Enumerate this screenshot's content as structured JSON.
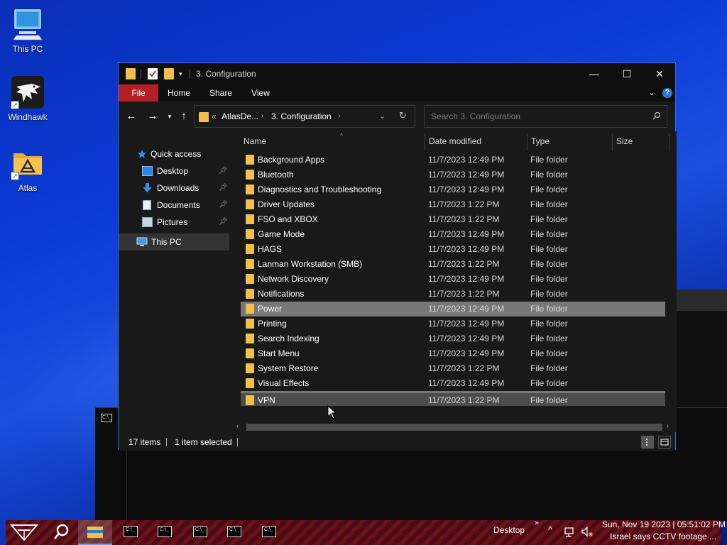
{
  "desktop": {
    "icons": [
      {
        "label": "This PC"
      },
      {
        "label": "Windhawk"
      },
      {
        "label": "Atlas"
      }
    ]
  },
  "explorer": {
    "title": "3. Configuration",
    "ribbon": {
      "file": "File",
      "home": "Home",
      "share": "Share",
      "view": "View",
      "help": "?"
    },
    "address": {
      "overflow": "«",
      "parent": "AtlasDe...",
      "current": "3. Configuration"
    },
    "search_placeholder": "Search 3. Configuration",
    "sidebar": {
      "quick_access": "Quick access",
      "items": [
        {
          "label": "Desktop",
          "icon": "desktop-icon",
          "pinned": true
        },
        {
          "label": "Downloads",
          "icon": "download-icon",
          "pinned": true
        },
        {
          "label": "Documents",
          "icon": "documents-icon",
          "pinned": true
        },
        {
          "label": "Pictures",
          "icon": "pictures-icon",
          "pinned": true
        }
      ],
      "this_pc": "This PC"
    },
    "columns": {
      "name": "Name",
      "date": "Date modified",
      "type": "Type",
      "size": "Size"
    },
    "rows": [
      {
        "name": "Background Apps",
        "date": "11/7/2023 12:49 PM",
        "type": "File folder"
      },
      {
        "name": "Bluetooth",
        "date": "11/7/2023 12:49 PM",
        "type": "File folder"
      },
      {
        "name": "Diagnostics and Troubleshooting",
        "date": "11/7/2023 12:49 PM",
        "type": "File folder"
      },
      {
        "name": "Driver Updates",
        "date": "11/7/2023 1:22 PM",
        "type": "File folder"
      },
      {
        "name": "FSO and XBOX",
        "date": "11/7/2023 1:22 PM",
        "type": "File folder"
      },
      {
        "name": "Game Mode",
        "date": "11/7/2023 12:49 PM",
        "type": "File folder"
      },
      {
        "name": "HAGS",
        "date": "11/7/2023 12:49 PM",
        "type": "File folder"
      },
      {
        "name": "Lanman Workstation (SMB)",
        "date": "11/7/2023 1:22 PM",
        "type": "File folder"
      },
      {
        "name": "Network Discovery",
        "date": "11/7/2023 12:49 PM",
        "type": "File folder"
      },
      {
        "name": "Notifications",
        "date": "11/7/2023 1:22 PM",
        "type": "File folder"
      },
      {
        "name": "Power",
        "date": "11/7/2023 12:49 PM",
        "type": "File folder"
      },
      {
        "name": "Printing",
        "date": "11/7/2023 12:49 PM",
        "type": "File folder"
      },
      {
        "name": "Search Indexing",
        "date": "11/7/2023 12:49 PM",
        "type": "File folder"
      },
      {
        "name": "Start Menu",
        "date": "11/7/2023 12:49 PM",
        "type": "File folder"
      },
      {
        "name": "System Restore",
        "date": "11/7/2023 1:22 PM",
        "type": "File folder"
      },
      {
        "name": "Visual Effects",
        "date": "11/7/2023 12:49 PM",
        "type": "File folder"
      },
      {
        "name": "VPN",
        "date": "11/7/2023 1:22 PM",
        "type": "File folder"
      }
    ],
    "selected_row": "Power",
    "hovered_row": "VPN",
    "status": {
      "count": "17 items",
      "selection": "1 item selected"
    }
  },
  "taskbar": {
    "desktop_label": "Desktop",
    "chevron": "»",
    "datetime": "Sun, Nov 19 2023 | 05:51:02 PM",
    "news": "Israel says CCTV footage ...",
    "console_buttons": 5
  },
  "colors": {
    "accent_red": "#b42025",
    "folder_yellow": "#f0c04b",
    "window_bg": "#191919",
    "selection": "#777777",
    "taskbar_red": "#6a1219"
  }
}
